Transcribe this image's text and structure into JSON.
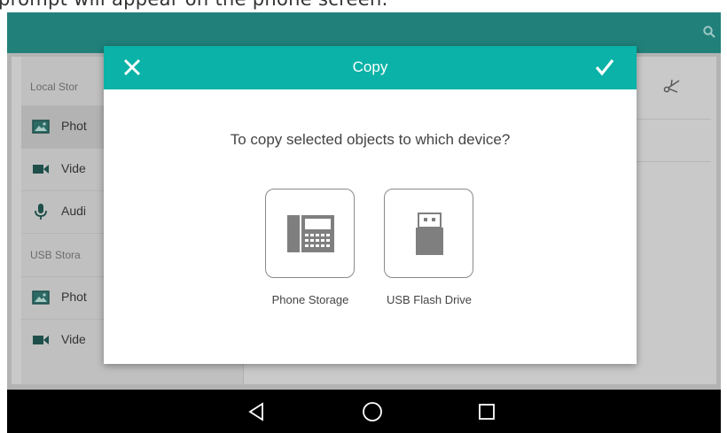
{
  "caption": "prompt will appear on the phone screen.",
  "appbar": {
    "search_icon": "search-icon",
    "color": "#21807a"
  },
  "sidebar": {
    "sections": [
      "Local Stor",
      "USB Stora"
    ],
    "items": [
      {
        "label": "Phot",
        "icon": "photo-icon",
        "selected": true
      },
      {
        "label": "Vide",
        "icon": "video-icon"
      },
      {
        "label": "Audi",
        "icon": "microphone-icon"
      },
      {
        "label": "Phot",
        "icon": "photo-icon"
      },
      {
        "label": "Vide",
        "icon": "video-icon"
      }
    ]
  },
  "toolbar": {
    "cut_icon": "scissors-icon"
  },
  "dialog": {
    "title": "Copy",
    "question": "To copy selected objects to which device?",
    "header_color": "#0bb2a7",
    "options": [
      {
        "label": "Phone Storage",
        "icon": "desk-phone-icon"
      },
      {
        "label": "USB Flash Drive",
        "icon": "usb-drive-icon"
      }
    ]
  },
  "navbar": {
    "buttons": [
      "back-icon",
      "home-icon",
      "recents-icon"
    ]
  }
}
